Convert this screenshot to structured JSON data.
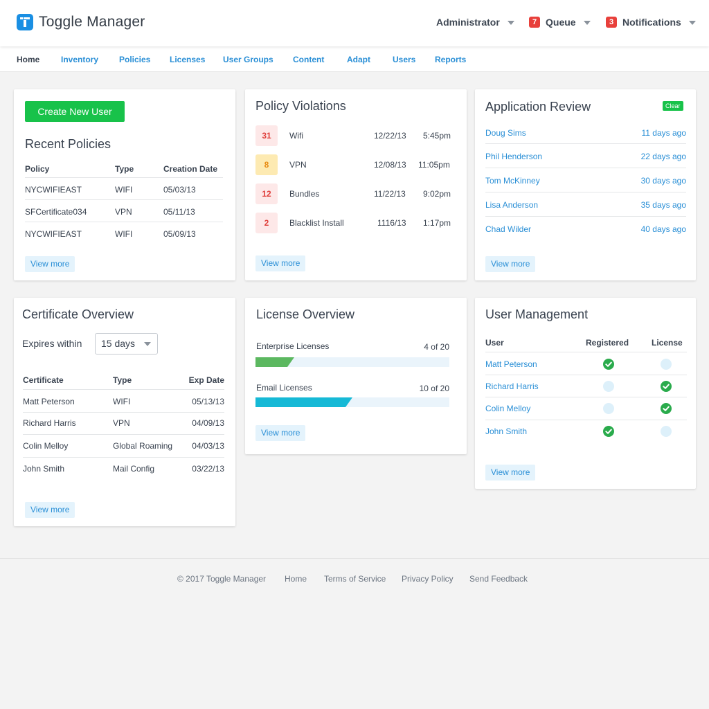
{
  "header": {
    "brand": "Toggle Manager",
    "user_menu": "Administrator",
    "queue": {
      "count": "7",
      "label": "Queue"
    },
    "notifications": {
      "count": "3",
      "label": "Notifications"
    }
  },
  "nav": [
    "Home",
    "Inventory",
    "Policies",
    "Licenses",
    "User Groups",
    "Content",
    "Adapt",
    "Users",
    "Reports"
  ],
  "recent_policies": {
    "create_button": "Create New User",
    "title": "Recent Policies",
    "columns": [
      "Policy",
      "Type",
      "Creation Date"
    ],
    "rows": [
      [
        "NYCWIFIEAST",
        "WIFI",
        "05/03/13"
      ],
      [
        "SFCertificate034",
        "VPN",
        "05/11/13"
      ],
      [
        "NYCWIFIEAST",
        "WIFI",
        "05/09/13"
      ]
    ],
    "more": "View more"
  },
  "policy_violations": {
    "title": "Policy Violations",
    "rows": [
      {
        "count": "31",
        "name": "Wifi",
        "date": "12/22/13",
        "time": "5:45pm",
        "severity": "red"
      },
      {
        "count": "8",
        "name": "VPN",
        "date": "12/08/13",
        "time": "11:05pm",
        "severity": "yellow"
      },
      {
        "count": "12",
        "name": "Bundles",
        "date": "11/22/13",
        "time": "9:02pm",
        "severity": "red"
      },
      {
        "count": "2",
        "name": "Blacklist Install",
        "date": "1116/13",
        "time": "1:17pm",
        "severity": "red"
      }
    ],
    "more": "View more"
  },
  "application_review": {
    "title": "Application Review",
    "clear": "Clear",
    "rows": [
      [
        "Doug Sims",
        "11 days ago"
      ],
      [
        "Phil Henderson",
        "22 days ago"
      ],
      [
        "Tom McKinney",
        "30 days ago"
      ],
      [
        "Lisa Anderson",
        "35 days ago"
      ],
      [
        "Chad Wilder",
        "40 days ago"
      ]
    ],
    "more": "View more"
  },
  "certificate_overview": {
    "title": "Certificate Overview",
    "expires_label": "Expires within",
    "expires_value": "15 days",
    "columns": [
      "Certificate",
      "Type",
      "Exp Date"
    ],
    "rows": [
      [
        "Matt Peterson",
        "WIFI",
        "05/13/13"
      ],
      [
        "Richard Harris",
        "VPN",
        "04/09/13"
      ],
      [
        "Colin Melloy",
        "Global Roaming",
        "04/03/13"
      ],
      [
        "John Smith",
        "Mail Config",
        "03/22/13"
      ]
    ],
    "more": "View more"
  },
  "license_overview": {
    "title": "License Overview",
    "licenses": [
      {
        "name": "Enterprise Licenses",
        "used_text": "4 of 20",
        "fraction": 0.2,
        "color": "#5cb860"
      },
      {
        "name": "Email Licenses",
        "used_text": "10 of 20",
        "fraction": 0.5,
        "color": "#16b9d6"
      }
    ],
    "more": "View more"
  },
  "user_management": {
    "title": "User Management",
    "columns": [
      "User",
      "Registered",
      "License"
    ],
    "rows": [
      {
        "name": "Matt Peterson",
        "registered": true,
        "license": false
      },
      {
        "name": "Richard Harris",
        "registered": false,
        "license": true
      },
      {
        "name": "Colin Melloy",
        "registered": false,
        "license": true
      },
      {
        "name": "John Smith",
        "registered": true,
        "license": false
      }
    ],
    "more": "View more"
  },
  "footer": [
    "© 2017 Toggle Manager",
    "Home",
    "Terms of Service",
    "Privacy Policy",
    "Send Feedback"
  ],
  "colors": {
    "accent": "#2a8fd6",
    "success": "#18c24a",
    "danger": "#e8403b"
  },
  "icons": {
    "logo": "toggle-logo-icon",
    "check": "check-circle-icon",
    "caret": "chevron-down-icon"
  }
}
